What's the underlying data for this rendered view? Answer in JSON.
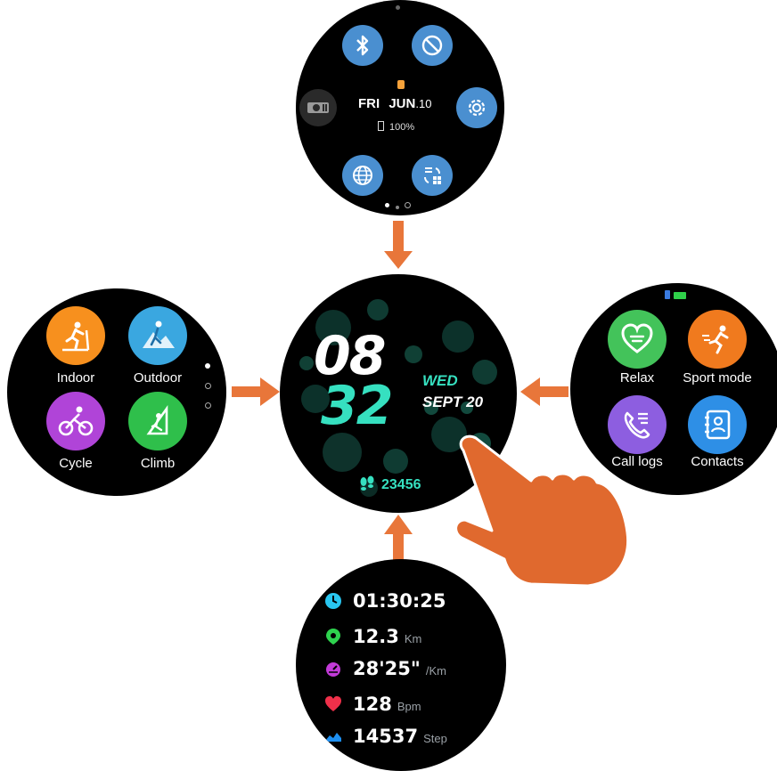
{
  "quick_panel": {
    "day": "FRI",
    "month": "JUN",
    "date": "10",
    "battery": "100%",
    "page_dots": 3,
    "buttons": [
      "bluetooth-icon",
      "do-not-disturb-icon",
      "settings-icon",
      "globe-icon",
      "app-layout-icon",
      "flashlight-icon"
    ]
  },
  "watch_face": {
    "hour": "08",
    "minute": "32",
    "weekday": "WED",
    "date": "SEPT 20",
    "steps": "23456",
    "accent": "#36e0c0"
  },
  "sports_menu": {
    "items": [
      {
        "label": "Indoor",
        "color": "#f7901e"
      },
      {
        "label": "Outdoor",
        "color": "#3aa7e0"
      },
      {
        "label": "Cycle",
        "color": "#b044d8"
      },
      {
        "label": "Climb",
        "color": "#2fbf4b"
      }
    ]
  },
  "apps_menu": {
    "items": [
      {
        "label": "Relax",
        "color": "#43c35a"
      },
      {
        "label": "Sport mode",
        "color": "#f07a1e"
      },
      {
        "label": "Call logs",
        "color": "#8d5ee0"
      },
      {
        "label": "Contacts",
        "color": "#2e8fe6"
      }
    ]
  },
  "workout_stats": {
    "rows": [
      {
        "value": "01:30:25",
        "unit": "",
        "icon": "clock-icon",
        "color": "#29c6f0"
      },
      {
        "value": "12.3",
        "unit": "Km",
        "icon": "location-pin-icon",
        "color": "#2ed24e"
      },
      {
        "value": "28'25\"",
        "unit": "/Km",
        "icon": "pace-icon",
        "color": "#c23ad8"
      },
      {
        "value": "128",
        "unit": "Bpm",
        "icon": "heart-icon",
        "color": "#f0304a"
      },
      {
        "value": "14537",
        "unit": "Step",
        "icon": "shoe-icon",
        "color": "#1e8ff0"
      }
    ]
  },
  "arrow_color": "#e8763a"
}
